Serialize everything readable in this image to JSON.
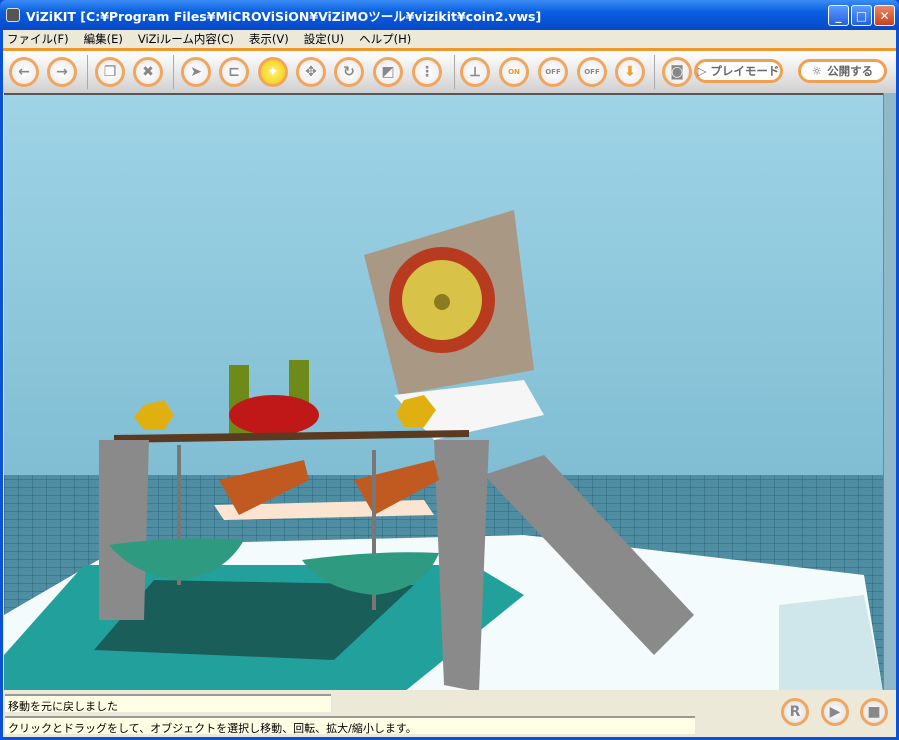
{
  "window": {
    "title": "ViZiKIT [C:¥Program Files¥MiCROViSiON¥ViZiMOツール¥vizikit¥coin2.vws]",
    "minimize": "_",
    "maximize": "□",
    "close": "✕"
  },
  "menu": [
    "ファイル(F)",
    "編集(E)",
    "ViZiルーム内容(C)",
    "表示(V)",
    "設定(U)",
    "ヘルプ(H)"
  ],
  "toolbar": {
    "icons": [
      "back-icon",
      "forward-icon",
      "restore-icon",
      "delete-icon",
      "select-arrow-icon",
      "link-icon",
      "target-icon",
      "move-icon",
      "rotate-icon",
      "scale-icon",
      "text-icon",
      "axes-icon",
      "grid-on-icon",
      "arrow-off-icon",
      "box-off-icon",
      "drop-icon",
      "camera-icon"
    ],
    "grid_on": "ON",
    "off": "OFF",
    "play_mode": "▷ プレイモード",
    "publish": "公開する"
  },
  "status": {
    "message": "移動を元に戻しました",
    "hint": "クリックとドラッグをして、オブジェクトを選択し移動、回転、拡大/縮小します。"
  },
  "controls": {
    "reset": "R",
    "play": "▶",
    "stop": "■"
  }
}
